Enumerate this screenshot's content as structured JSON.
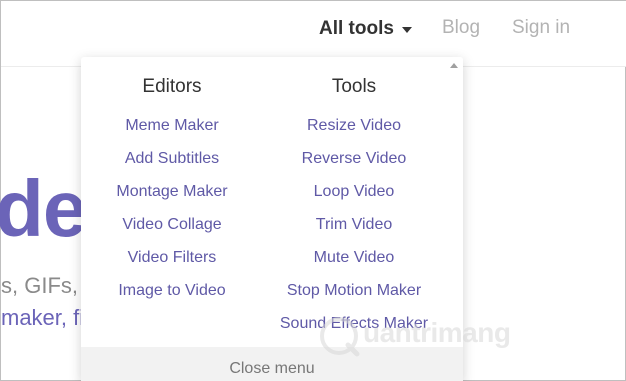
{
  "nav": {
    "all_tools": "All tools",
    "blog": "Blog",
    "sign_in": "Sign in"
  },
  "hero": {
    "partial_word": "de",
    "line1": "s, GIFs, a",
    "line2": "maker, fi"
  },
  "dropdown": {
    "editors": {
      "heading": "Editors",
      "items": [
        "Meme Maker",
        "Add Subtitles",
        "Montage Maker",
        "Video Collage",
        "Video Filters",
        "Image to Video"
      ]
    },
    "tools": {
      "heading": "Tools",
      "items": [
        "Resize Video",
        "Reverse Video",
        "Loop Video",
        "Trim Video",
        "Mute Video",
        "Stop Motion Maker",
        "Sound Effects Maker"
      ]
    },
    "close_label": "Close menu"
  },
  "watermark": {
    "text": "uantrimang"
  },
  "colors": {
    "accent": "#6b64b8",
    "link": "#5f59a6",
    "nav_active": "#333333",
    "nav_muted": "#b3b3b3"
  }
}
